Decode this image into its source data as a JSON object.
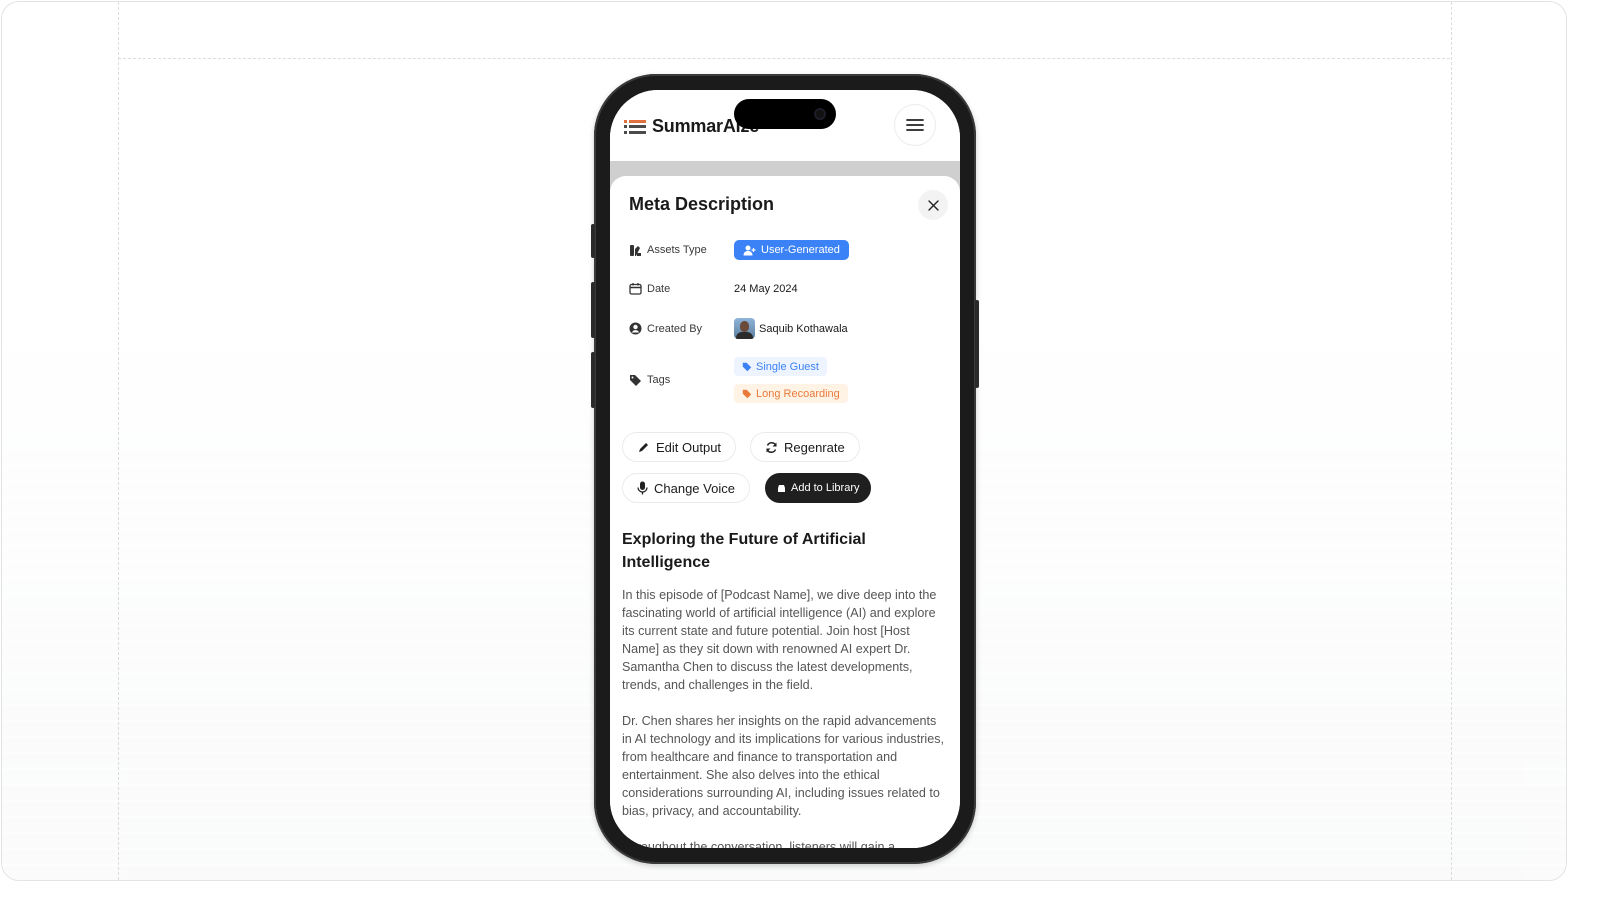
{
  "app": {
    "name": "SummarAIze",
    "logo_icon": "list-lines-icon",
    "menu_icon": "hamburger-icon"
  },
  "sheet": {
    "title": "Meta Description",
    "close_icon": "close-icon",
    "meta": {
      "assets_type": {
        "label": "Assets Type",
        "icon": "assets-icon",
        "value": "User-Generated",
        "value_icon": "user-plus-icon",
        "color": "#3b82f6"
      },
      "date": {
        "label": "Date",
        "icon": "calendar-icon",
        "value": "24 May 2024"
      },
      "created_by": {
        "label": "Created By",
        "icon": "user-circle-icon",
        "value": "Saquib Kothawala"
      },
      "tags": {
        "label": "Tags",
        "icon": "tag-icon",
        "items": [
          {
            "label": "Single Guest",
            "color": "#3b82f6"
          },
          {
            "label": "Long Recoarding",
            "color": "#ea7a3b"
          }
        ]
      }
    },
    "actions": {
      "edit_output": "Edit Output",
      "regenerate": "Regenrate",
      "change_voice": "Change Voice",
      "add_to_library": "Add to Library"
    },
    "article": {
      "title": "Exploring the Future of Artificial Intelligence",
      "paragraphs": [
        "In this episode of [Podcast Name], we dive deep into the fascinating world of artificial intelligence (AI) and explore its current state and future potential. Join host [Host Name] as they sit down with renowned AI expert Dr. Samantha Chen to discuss the latest developments, trends, and challenges in the field.",
        "Dr. Chen shares her insights on the rapid advancements in AI technology and its implications for various industries, from healthcare and finance to transportation and entertainment. She also delves into the ethical considerations surrounding AI, including issues related to bias, privacy, and accountability.",
        "Throughout the conversation, listeners will gain a"
      ]
    }
  }
}
